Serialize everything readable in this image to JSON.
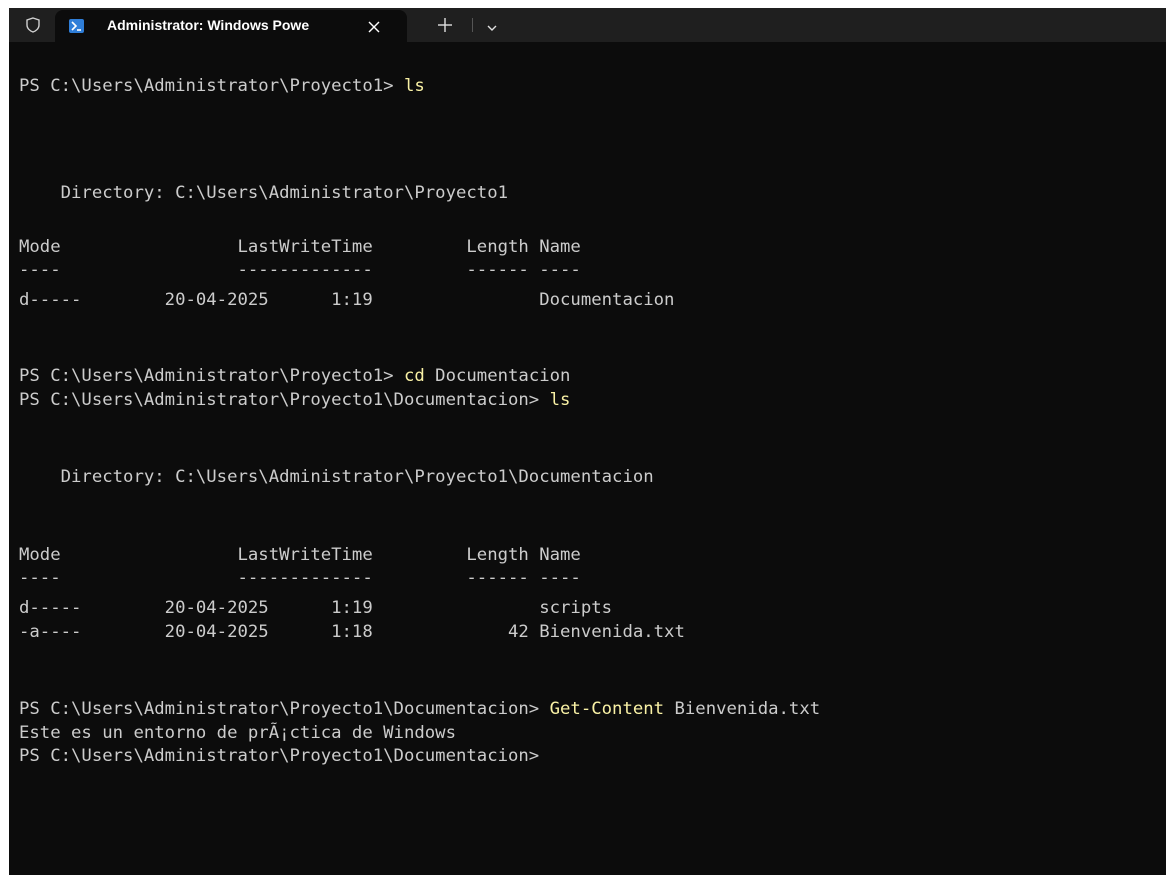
{
  "tab": {
    "title": "Administrator: Windows Powe",
    "close_icon": "close-icon",
    "new_tab_icon": "plus-icon",
    "dropdown_icon": "chevron-down-icon"
  },
  "colors": {
    "background": "#0c0c0c",
    "titlebar": "#1f1f1f",
    "text": "#cccccc",
    "command": "#f9f1a5",
    "powershell_icon": "#2f7ed8"
  },
  "terminal": {
    "lines": [
      {
        "prompt": "PS C:\\Users\\Administrator\\Proyecto1> ",
        "command": "ls",
        "args": ""
      },
      {
        "text": "    Directory: C:\\Users\\Administrator\\Proyecto1"
      },
      {
        "text": "Mode                 LastWriteTime         Length Name"
      },
      {
        "text": "----                 -------------         ------ ----"
      },
      {
        "text": "d-----        20-04-2025      1:19                Documentacion"
      },
      {
        "prompt": "PS C:\\Users\\Administrator\\Proyecto1> ",
        "command": "cd",
        "args": " Documentacion"
      },
      {
        "prompt": "PS C:\\Users\\Administrator\\Proyecto1\\Documentacion> ",
        "command": "ls",
        "args": ""
      },
      {
        "text": "    Directory: C:\\Users\\Administrator\\Proyecto1\\Documentacion"
      },
      {
        "text": "Mode                 LastWriteTime         Length Name"
      },
      {
        "text": "----                 -------------         ------ ----"
      },
      {
        "text": "d-----        20-04-2025      1:19                scripts"
      },
      {
        "text": "-a----        20-04-2025      1:18             42 Bienvenida.txt"
      },
      {
        "prompt": "PS C:\\Users\\Administrator\\Proyecto1\\Documentacion> ",
        "command": "Get-Content",
        "args": " Bienvenida.txt"
      },
      {
        "text": "Este es un entorno de prÃ¡ctica de Windows"
      },
      {
        "prompt": "PS C:\\Users\\Administrator\\Proyecto1\\Documentacion>",
        "command": "",
        "args": ""
      }
    ]
  }
}
